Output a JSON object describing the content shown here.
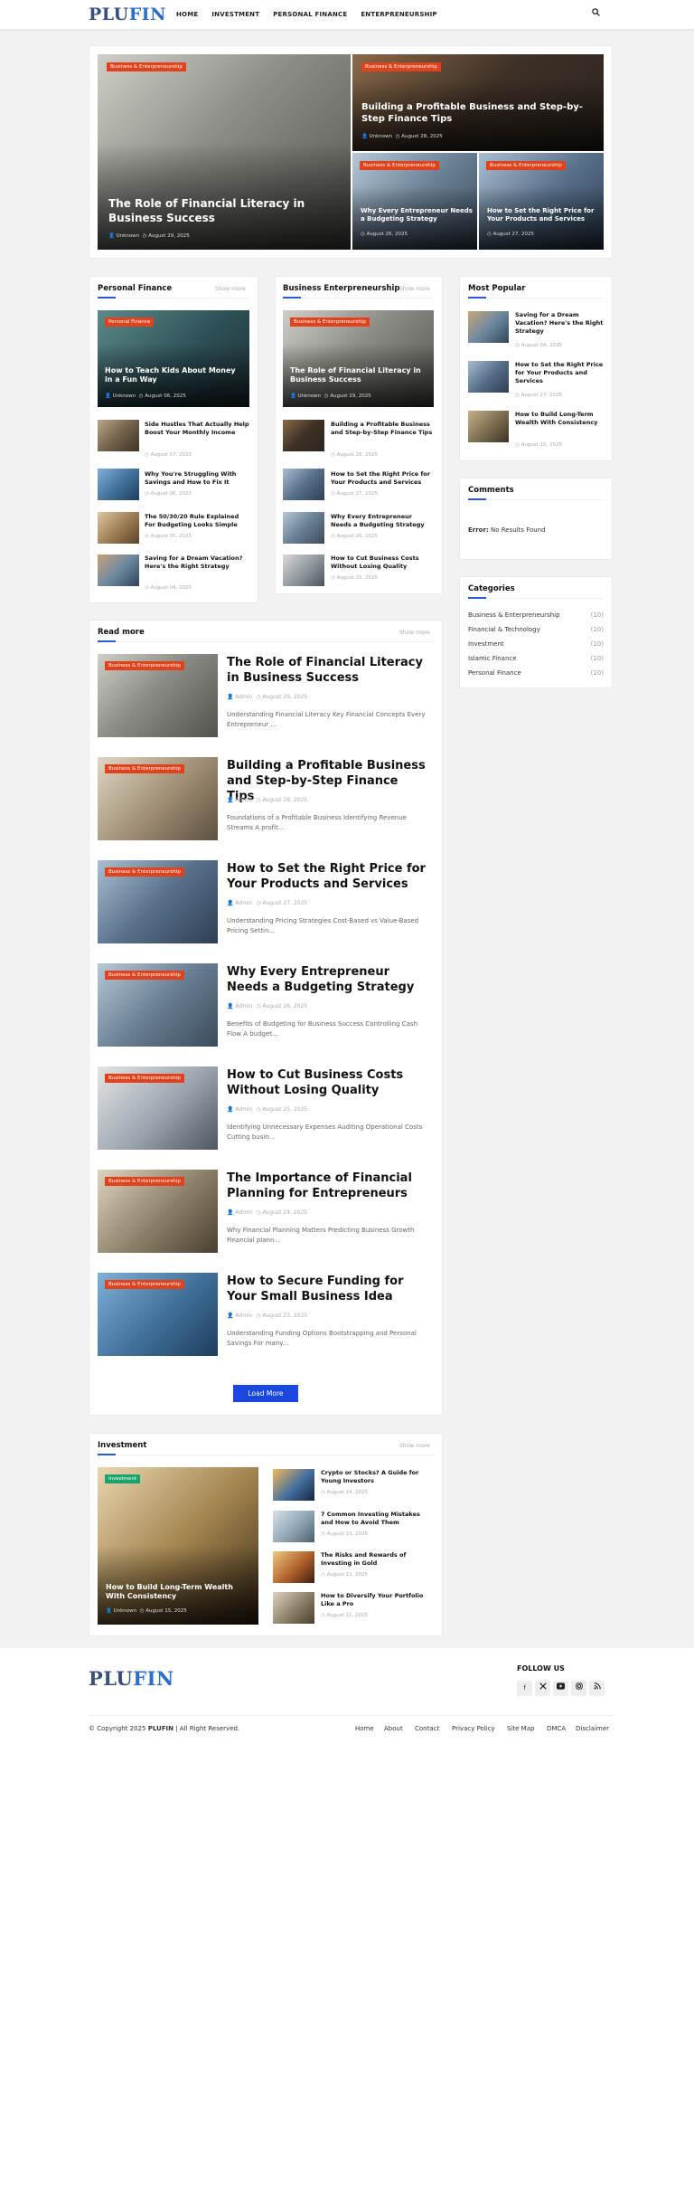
{
  "header": {
    "logo_a": "PLU",
    "logo_b": "FIN",
    "nav": [
      "HOME",
      "INVESTMENT",
      "PERSONAL FINANCE",
      "ENTERPRENEURSHIP"
    ],
    "search_icon": "search-icon"
  },
  "hero": {
    "main": {
      "tag": "Business & Enterpreneurship",
      "title": "The Role of Financial Literacy in Business Success",
      "author": "Unknown",
      "date": "August 29, 2025"
    },
    "top": {
      "tag": "Business & Enterpreneurship",
      "title": "Building a Profitable Business and Step-by-Step Finance Tips",
      "author": "Unknown",
      "date": "August 28, 2025"
    },
    "bl": {
      "tag": "Business & Enterpreneurship",
      "title": "Why Every Entrepreneur Needs a Budgeting Strategy",
      "date": "August 26, 2025"
    },
    "br": {
      "tag": "Business & Enterpreneurship",
      "title": "How to Set the Right Price for Your Products and Services",
      "date": "August 27, 2025"
    }
  },
  "personal": {
    "heading": "Personal Finance",
    "show_more": "Show more",
    "feature": {
      "tag": "Personal Finance",
      "title": "How to Teach Kids About Money in a Fun Way",
      "author": "Unknown",
      "date": "August 06, 2025"
    },
    "items": [
      {
        "title": "Side Hustles That Actually Help Boost Your Monthly Income",
        "date": "August 07, 2025"
      },
      {
        "title": "Why You're Struggling With Savings and How to Fix It",
        "date": "August 06, 2025"
      },
      {
        "title": "The 50/30/20 Rule Explained For Budgeting Looks Simple",
        "date": "August 05, 2025"
      },
      {
        "title": "Saving for a Dream Vacation? Here's the Right Strategy",
        "date": "August 04, 2025"
      }
    ]
  },
  "business": {
    "heading": "Business Enterpreneurship",
    "show_more": "Show more",
    "feature": {
      "tag": "Business & Enterpreneurship",
      "title": "The Role of Financial Literacy in Business Success",
      "author": "Unknown",
      "date": "August 29, 2025"
    },
    "items": [
      {
        "title": "Building a Profitable Business and Step-by-Step Finance Tips",
        "date": "August 28, 2025"
      },
      {
        "title": "How to Set the Right Price for Your Products and Services",
        "date": "August 27, 2025"
      },
      {
        "title": "Why Every Entrepreneur Needs a Budgeting Strategy",
        "date": "August 26, 2025"
      },
      {
        "title": "How to Cut Business Costs Without Losing Quality",
        "date": "August 25, 2025"
      }
    ]
  },
  "popular": {
    "heading": "Most Popular",
    "items": [
      {
        "title": "Saving for a Dream Vacation? Here's the Right Strategy",
        "date": "August 04, 2025"
      },
      {
        "title": "How to Set the Right Price for Your Products and Services",
        "date": "August 27, 2025"
      },
      {
        "title": "How to Build Long-Term Wealth With Consistency",
        "date": "August 15, 2025"
      }
    ]
  },
  "comments": {
    "heading": "Comments",
    "error_label": "Error:",
    "error_text": " No Results Found"
  },
  "categories": {
    "heading": "Categories",
    "items": [
      {
        "name": "Business & Enterpreneurship",
        "count": "(10)"
      },
      {
        "name": "Financial & Technology",
        "count": "(10)"
      },
      {
        "name": "Investment",
        "count": "(10)"
      },
      {
        "name": "Islamic Finance",
        "count": "(10)"
      },
      {
        "name": "Personal Finance",
        "count": "(10)"
      }
    ]
  },
  "readmore": {
    "heading": "Read more",
    "show_more": "Show more",
    "load_more": "Load More",
    "posts": [
      {
        "tag": "Business & Enterpreneurship",
        "title": "The Role of Financial Literacy in Business Success",
        "author": "Admin",
        "date": "August 29, 2025",
        "snippet": "Understanding Financial Literacy Key Financial Concepts Every Entrepreneur ..."
      },
      {
        "tag": "Business & Enterpreneurship",
        "title": "Building a Profitable Business and Step-by-Step Finance Tips",
        "author": "Admin",
        "date": "August 28, 2025",
        "snippet": "Foundations of a Profitable Business Identifying Revenue Streams A profit..."
      },
      {
        "tag": "Business & Enterpreneurship",
        "title": "How to Set the Right Price for Your Products and Services",
        "author": "Admin",
        "date": "August 27, 2025",
        "snippet": "Understanding Pricing Strategies Cost-Based vs Value-Based Pricing Settin..."
      },
      {
        "tag": "Business & Enterpreneurship",
        "title": "Why Every Entrepreneur Needs a Budgeting Strategy",
        "author": "Admin",
        "date": "August 26, 2025",
        "snippet": "Benefits of Budgeting for Business Success Controlling Cash Flow A budget..."
      },
      {
        "tag": "Business & Enterpreneurship",
        "title": "How to Cut Business Costs Without Losing Quality",
        "author": "Admin",
        "date": "August 25, 2025",
        "snippet": "Identifying Unnecessary Expenses Auditing Operational Costs Cutting busin..."
      },
      {
        "tag": "Business & Enterpreneurship",
        "title": "The Importance of Financial Planning for Entrepreneurs",
        "author": "Admin",
        "date": "August 24, 2025",
        "snippet": "Why Financial Planning Matters Predicting Business Growth Financial plann..."
      },
      {
        "tag": "Business & Enterpreneurship",
        "title": "How to Secure Funding for Your Small Business Idea",
        "author": "Admin",
        "date": "August 23, 2025",
        "snippet": "Understanding Funding Options Bootstrapping and Personal Savings For many..."
      }
    ]
  },
  "investment": {
    "heading": "Investment",
    "show_more": "Show more",
    "feature": {
      "tag": "Investment",
      "title": "How to Build Long-Term Wealth With Consistency",
      "author": "Unknown",
      "date": "August 15, 2025"
    },
    "items": [
      {
        "title": "Crypto or Stocks? A Guide for Young Investors",
        "date": "August 14, 2025"
      },
      {
        "title": "7 Common Investing Mistakes and How to Avoid Them",
        "date": "August 13, 2025"
      },
      {
        "title": "The Risks and Rewards of Investing in Gold",
        "date": "August 12, 2025"
      },
      {
        "title": "How to Diversify Your Portfolio Like a Pro",
        "date": "August 11, 2025"
      }
    ]
  },
  "footer": {
    "logo_a": "PLU",
    "logo_b": "FIN",
    "follow": "FOLLOW US",
    "social": [
      "facebook-icon",
      "twitter-icon",
      "youtube-icon",
      "instagram-icon",
      "rss-icon"
    ],
    "copyright_pre": "© Copyright 2025 ",
    "copyright_brand": "PLUFIN",
    "copyright_post": " | All Right Reserved.",
    "links": [
      "Home",
      "About",
      "Contact",
      "Privacy Policy",
      "Site Map",
      "DMCA",
      "Disclaimer"
    ]
  }
}
